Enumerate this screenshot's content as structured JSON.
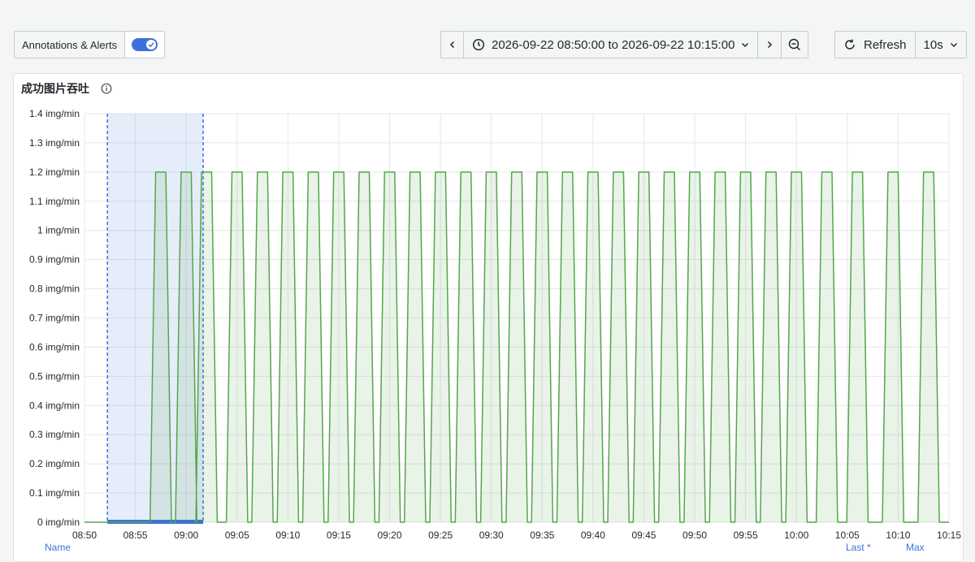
{
  "toolbar": {
    "annotations_label": "Annotations & Alerts",
    "annotations_enabled": true,
    "time_range": "2026-09-22 08:50:00 to 2026-09-22 10:15:00",
    "refresh_label": "Refresh",
    "refresh_interval": "10s"
  },
  "panel": {
    "title": "成功图片吞吐",
    "legend_headers": {
      "name": "Name",
      "last": "Last *",
      "max": "Max"
    }
  },
  "colors": {
    "series": "#56a64b",
    "selection": "#3d71d9"
  },
  "chart_data": {
    "type": "area",
    "ylim": [
      0,
      1.4
    ],
    "y_ticks": [
      "0 img/min",
      "0.1 img/min",
      "0.2 img/min",
      "0.3 img/min",
      "0.4 img/min",
      "0.5 img/min",
      "0.6 img/min",
      "0.7 img/min",
      "0.8 img/min",
      "0.9 img/min",
      "1 img/min",
      "1.1 img/min",
      "1.2 img/min",
      "1.3 img/min",
      "1.4 img/min"
    ],
    "x_ticks": [
      "08:50",
      "08:55",
      "09:00",
      "09:05",
      "09:10",
      "09:15",
      "09:20",
      "09:25",
      "09:30",
      "09:35",
      "09:40",
      "09:45",
      "09:50",
      "09:55",
      "10:00",
      "10:05",
      "10:10",
      "10:15"
    ],
    "x_range_minutes": [
      "08:50",
      "10:15"
    ],
    "grid": true,
    "series": [
      {
        "peak_value": 1.2,
        "peak_centers": [
          "08:57:30",
          "09:00:00",
          "09:02:00",
          "09:05:00",
          "09:07:30",
          "09:10:00",
          "09:12:30",
          "09:15:00",
          "09:17:30",
          "09:20:00",
          "09:22:30",
          "09:25:00",
          "09:27:30",
          "09:30:00",
          "09:32:30",
          "09:35:00",
          "09:37:30",
          "09:40:00",
          "09:42:30",
          "09:45:00",
          "09:47:30",
          "09:50:00",
          "09:52:30",
          "09:55:00",
          "09:57:30",
          "10:00:00",
          "10:03:00",
          "10:06:00",
          "10:09:30",
          "10:13:00"
        ]
      }
    ],
    "selection_range": [
      "08:52:15",
      "09:01:40"
    ]
  }
}
